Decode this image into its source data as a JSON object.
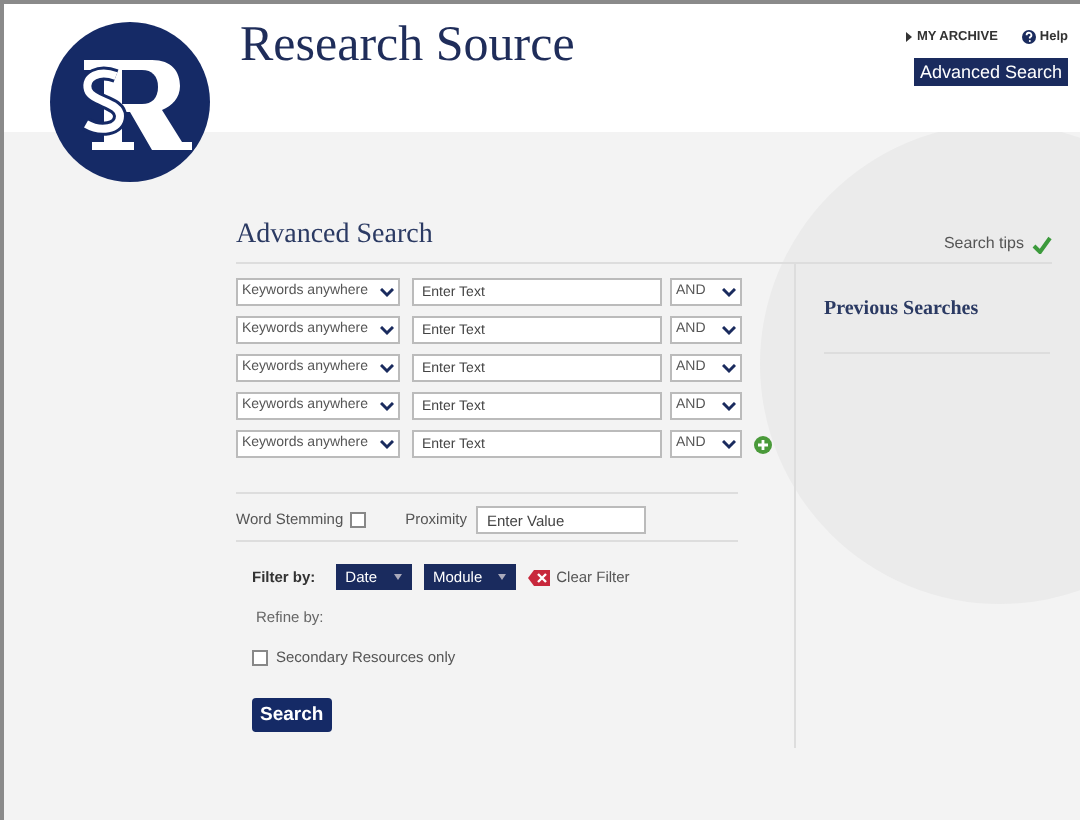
{
  "header": {
    "title": "Research Source",
    "links": [
      {
        "kind": "archive",
        "label": "MY ARCHIVE"
      },
      {
        "kind": "help",
        "label": "Help"
      }
    ],
    "button": "Advanced Search"
  },
  "search": {
    "title": "Advanced Search",
    "tips": "Search tips",
    "rows": [
      {
        "field": "Keywords anywhere",
        "placeholder": "Enter Text",
        "operator": "AND",
        "add": false
      },
      {
        "field": "Keywords anywhere",
        "placeholder": "Enter Text",
        "operator": "AND",
        "add": false
      },
      {
        "field": "Keywords anywhere",
        "placeholder": "Enter Text",
        "operator": "AND",
        "add": false
      },
      {
        "field": "Keywords anywhere",
        "placeholder": "Enter Text",
        "operator": "AND",
        "add": false
      },
      {
        "field": "Keywords anywhere",
        "placeholder": "Enter Text",
        "operator": "AND",
        "add": true
      }
    ],
    "word_stemming": {
      "label": "Word Stemming",
      "checked": false
    },
    "proximity": {
      "label": "Proximity",
      "placeholder": "Enter Value"
    },
    "filter": {
      "label": "Filter by:",
      "buttons": [
        "Date",
        "Module"
      ],
      "clear": "Clear Filter"
    },
    "refine_label": "Refine by:",
    "secondary": {
      "label": "Secondary Resources only",
      "checked": false
    },
    "submit": "Search"
  },
  "previous_searches": {
    "title": "Previous Searches"
  }
}
